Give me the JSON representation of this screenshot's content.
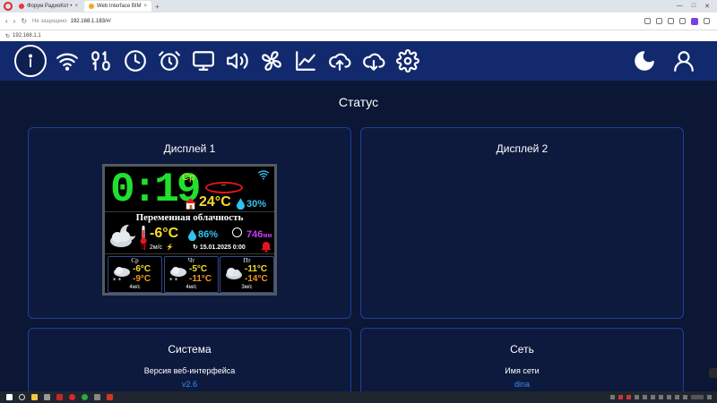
{
  "browser": {
    "tabs": [
      {
        "label": "Форум РадиоКот •"
      },
      {
        "label": "Web Interface BIM"
      }
    ],
    "security_label": "Не защищено",
    "url": "192.168.1.183/#/",
    "status_url": "192.168.1.1"
  },
  "navbar": {
    "icons": [
      "info-icon",
      "wifi-icon",
      "binary-icon",
      "clock-icon",
      "alarm-icon",
      "monitor-icon",
      "speaker-icon",
      "fan-icon",
      "chart-icon",
      "cloud-upload-icon",
      "cloud-download-icon",
      "gear-icon"
    ],
    "right_icons": [
      "moon-icon",
      "user-icon"
    ]
  },
  "page": {
    "title": "Статус"
  },
  "display1": {
    "title": "Дисплей 1",
    "lcd": {
      "clock": "0:19",
      "weekday": "Ср",
      "indoor_temp_marker": "–",
      "indoor_temp": "24°C",
      "indoor_humidity": "30%",
      "condition": "Переменная облачность",
      "outdoor_temp": "-6°C",
      "outdoor_humidity": "86%",
      "pressure_value": "746",
      "pressure_unit": "мм",
      "wind": "2м/с",
      "datetime": "15.01.2025 0:00",
      "forecast": [
        {
          "day": "Ср",
          "max": "-6°C",
          "min": "-9°C",
          "wind": "4м/с"
        },
        {
          "day": "Чт",
          "max": "-5°C",
          "min": "-11°C",
          "wind": "4м/с"
        },
        {
          "day": "Пт",
          "max": "-11°C",
          "min": "-14°C",
          "wind": "3м/с"
        }
      ]
    }
  },
  "display2": {
    "title": "Дисплей 2"
  },
  "system": {
    "title": "Система",
    "label": "Версия веб-интерфейса",
    "value": "v2.6"
  },
  "network": {
    "title": "Сеть",
    "label": "Имя сети",
    "value": "dina"
  },
  "colors": {
    "page_bg": "#0b1734",
    "navbar_bg": "#122a6d",
    "card_border": "#1f3e9c",
    "link_blue": "#3a8cf2",
    "lcd_green": "#20e02f",
    "lcd_yellow": "#f5dd2a",
    "lcd_cyan": "#31c2f0",
    "lcd_purple": "#c63cf0"
  }
}
